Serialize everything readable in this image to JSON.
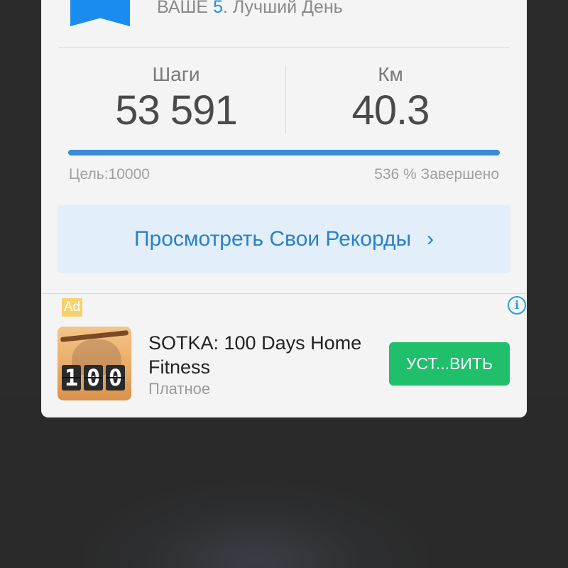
{
  "best_day": {
    "prefix": "ВАШЕ ",
    "number": "5",
    "suffix": ". Лучший День"
  },
  "stats": {
    "steps_label": "Шаги",
    "steps_value": "53 591",
    "km_label": "Км",
    "km_value": "40.3"
  },
  "progress": {
    "goal": "Цель:10000",
    "complete": "536 % Завершено",
    "fill_fraction": 1.0
  },
  "records_button": {
    "label": "Просмотреть Свои Рекорды",
    "chevron": "›"
  },
  "ad": {
    "badge": "Ad",
    "info_icon": "info-icon",
    "app_icon_digits": [
      "1",
      "0",
      "0"
    ],
    "title": "SOTKA: 100 Days Home Fitness",
    "subtitle": "Платное",
    "install_label": "УСТ...ВИТЬ"
  },
  "colors": {
    "accent": "#2a80c8",
    "ribbon": "#1a8cf0",
    "install": "#1fbf6c",
    "ad_badge": "#f6d26e"
  }
}
